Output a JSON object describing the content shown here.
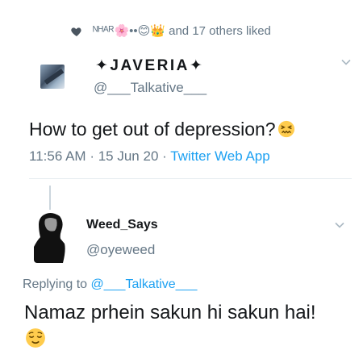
{
  "liked": {
    "icon": "heart-icon",
    "names_glyphs": "ᴺᴴᴬᴿ🌸••😊👑",
    "suffix": "and 17 others liked"
  },
  "tweet": {
    "display_name": "✦JAVERIA✦",
    "handle": "@___Talkative___",
    "text": "How to get out of depression?",
    "emoji": "confounded-face",
    "time": "11:56 AM",
    "date": "15 Jun 20",
    "separator": "·",
    "source": "Twitter Web App"
  },
  "reply": {
    "display_name": "Weed_Says",
    "handle": "@oyeweed",
    "replying_prefix": "Replying to",
    "replying_to": "@___Talkative___",
    "text": "Namaz prhein sakun hi sakun hai!",
    "emoji": "relieved-face"
  },
  "colors": {
    "text": "#14171a",
    "secondary": "#657786",
    "link": "#1da1f2",
    "divider": "#e6ecf0",
    "emoji_yellow": "#ffcc4d"
  }
}
